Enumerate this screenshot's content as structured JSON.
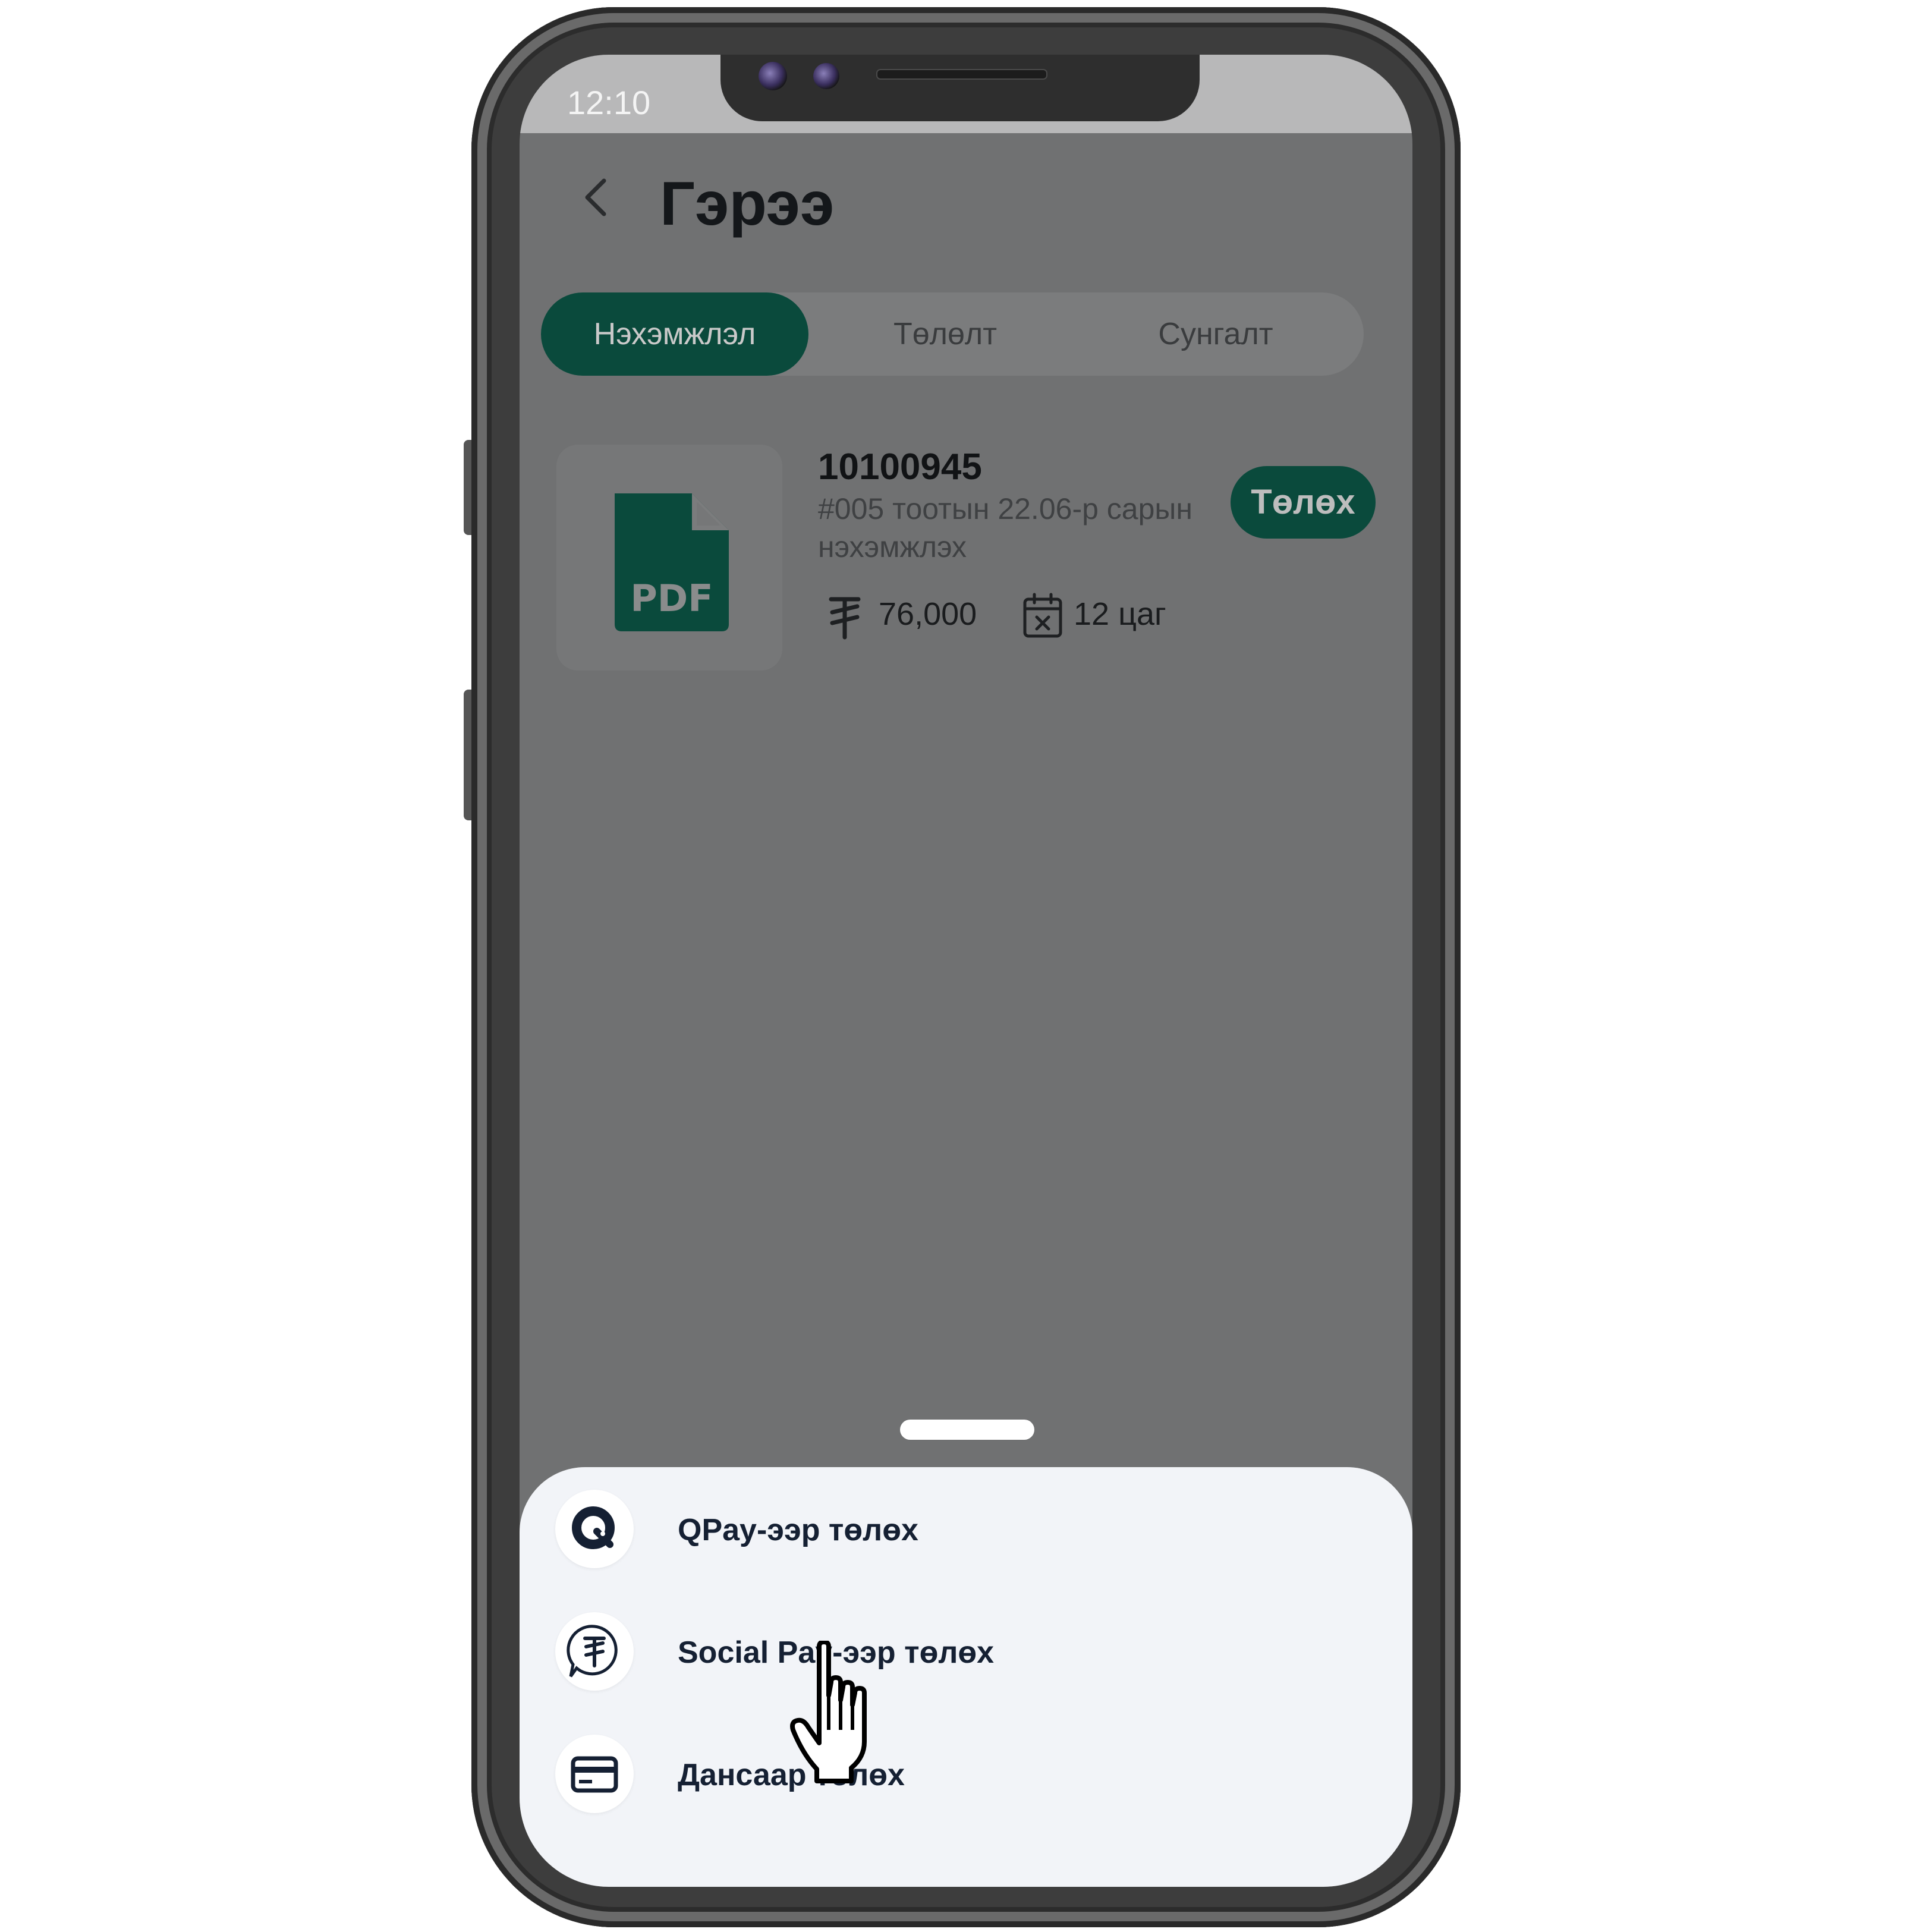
{
  "status_bar": {
    "time": "12:10"
  },
  "header": {
    "title": "Гэрээ"
  },
  "tabs": [
    {
      "label": "Нэхэмжлэл",
      "active": true
    },
    {
      "label": "Төлөлт",
      "active": false
    },
    {
      "label": "Сунгалт",
      "active": false
    }
  ],
  "invoice": {
    "number": "10100945",
    "description": "#005 тоотын 22.06-р сарын нэхэмжлэх",
    "amount": "76,000",
    "time_left": "12 цаг",
    "file_badge": "PDF",
    "pay_label": "Төлөх"
  },
  "payment_sheet": {
    "options": [
      {
        "label": "QPay-ээр төлөх",
        "icon": "qpay-icon"
      },
      {
        "label": "Social Pay-ээр төлөх",
        "icon": "socialpay-icon"
      },
      {
        "label": "Дансаар төлөх",
        "icon": "card-icon"
      }
    ]
  },
  "colors": {
    "accent": "#0a4a3c",
    "overlay": "#707172",
    "sheet": "#f2f4f8",
    "text_dark": "#152033"
  }
}
